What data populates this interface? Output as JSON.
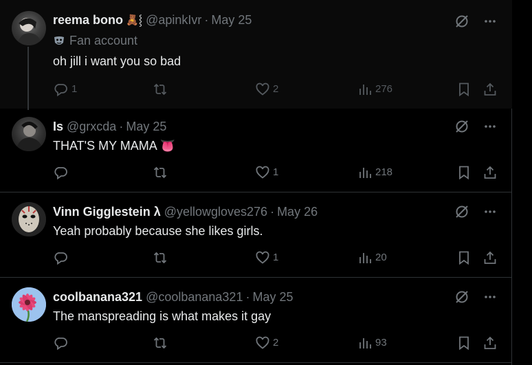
{
  "colors": {
    "background": "#000000",
    "text": "#e7e9ea",
    "muted": "#71767b",
    "divider": "#2f3336"
  },
  "tweets": [
    {
      "name": "reema bono",
      "badges": "🧸⸾",
      "handle": "@apinkIvr",
      "date": "May 25",
      "label": "Fan account",
      "text": "oh jill i want you so bad",
      "replies": "1",
      "likes": "2",
      "views": "276"
    },
    {
      "name": "Is",
      "handle": "@grxcda",
      "date": "May 25",
      "text": "THAT'S MY MAMA 👅",
      "replies": "",
      "likes": "1",
      "views": "218"
    },
    {
      "name": "Vinn Gigglestein λ",
      "handle": "@yellowgloves276",
      "date": "May 26",
      "text": "Yeah probably because she likes girls.",
      "replies": "",
      "likes": "1",
      "views": "20"
    },
    {
      "name": "coolbanana321",
      "handle": "@coolbanana321",
      "date": "May 25",
      "text": "The manspreading is what makes it gay",
      "replies": "",
      "likes": "2",
      "views": "93"
    }
  ]
}
